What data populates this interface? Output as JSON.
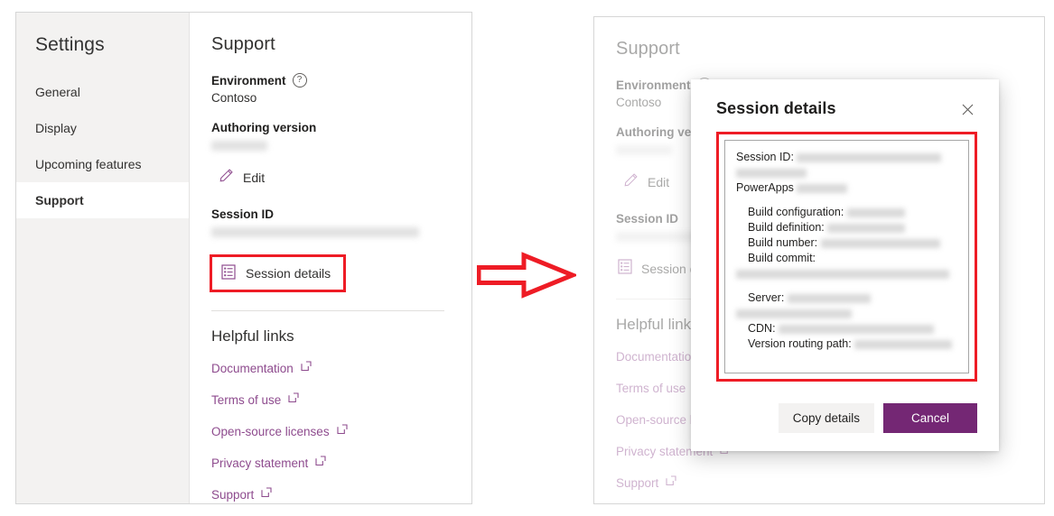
{
  "settings": {
    "title": "Settings",
    "nav_items": [
      {
        "label": "General",
        "selected": false
      },
      {
        "label": "Display",
        "selected": false
      },
      {
        "label": "Upcoming features",
        "selected": false
      },
      {
        "label": "Support",
        "selected": true
      }
    ]
  },
  "support_page": {
    "title": "Support",
    "environment_label": "Environment",
    "environment_help_icon": "help-circle-icon",
    "environment_value": "Contoso",
    "authoring_version_label": "Authoring version",
    "authoring_version_value": "",
    "edit_icon": "pencil-icon",
    "edit_label": "Edit",
    "session_id_label": "Session ID",
    "session_id_value": "",
    "session_details_icon": "list-document-icon",
    "session_details_label": "Session details",
    "helpful_links_title": "Helpful links",
    "links": [
      {
        "label": "Documentation",
        "icon": "external-link-icon"
      },
      {
        "label": "Terms of use",
        "icon": "external-link-icon"
      },
      {
        "label": "Open-source licenses",
        "icon": "external-link-icon"
      },
      {
        "label": "Privacy statement",
        "icon": "external-link-icon"
      },
      {
        "label": "Support",
        "icon": "external-link-icon"
      }
    ]
  },
  "dialog": {
    "title": "Session details",
    "close_icon": "close-icon",
    "details": {
      "session_id_label": "Session ID:",
      "session_id_value": "",
      "session_id_value_cont": "",
      "powerapps_label": "PowerApps",
      "powerapps_value": "",
      "build_configuration_label": "Build configuration:",
      "build_configuration_value": "",
      "build_definition_label": "Build definition:",
      "build_definition_value": "",
      "build_number_label": "Build number:",
      "build_number_value": "",
      "build_commit_label": "Build commit:",
      "build_commit_value": "",
      "server_label": "Server:",
      "server_value": "",
      "server_value_cont": "",
      "cdn_label": "CDN:",
      "cdn_value": "",
      "version_routing_path_label": "Version routing path:",
      "version_routing_path_value": ""
    },
    "copy_details_label": "Copy details",
    "cancel_label": "Cancel"
  },
  "annotation": {
    "arrow_icon": "right-arrow-icon",
    "highlight_color": "#ee1c25"
  },
  "theme": {
    "accent_purple": "#742774",
    "link_purple": "#8e4b8e",
    "sidebar_bg": "#f3f2f1"
  }
}
